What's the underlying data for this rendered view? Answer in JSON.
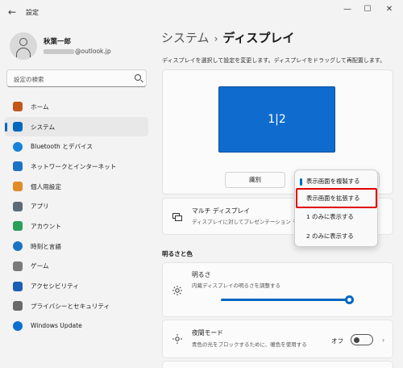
{
  "window": {
    "title": "設定",
    "back_icon": "arrow-left-icon",
    "min_glyph": "—",
    "max_glyph": "☐",
    "close_glyph": "✕"
  },
  "profile": {
    "name": "秋葉一郎",
    "email_suffix": "@outlook.jp"
  },
  "search": {
    "placeholder": "設定の検索"
  },
  "nav": [
    {
      "label": "ホーム",
      "icon": "home-icon",
      "color": "#c2571a"
    },
    {
      "label": "システム",
      "icon": "system-icon",
      "color": "#0067c0",
      "active": true
    },
    {
      "label": "Bluetooth とデバイス",
      "icon": "bluetooth-icon",
      "color": "#1583d8"
    },
    {
      "label": "ネットワークとインターネット",
      "icon": "network-icon",
      "color": "#1a73c4"
    },
    {
      "label": "個人用設定",
      "icon": "brush-icon",
      "color": "#e08a2a"
    },
    {
      "label": "アプリ",
      "icon": "apps-icon",
      "color": "#5c6a7a"
    },
    {
      "label": "アカウント",
      "icon": "account-icon",
      "color": "#2aa05a"
    },
    {
      "label": "時刻と言語",
      "icon": "time-language-icon",
      "color": "#1a73c4"
    },
    {
      "label": "ゲーム",
      "icon": "game-icon",
      "color": "#7a7a7a"
    },
    {
      "label": "アクセシビリティ",
      "icon": "accessibility-icon",
      "color": "#1a5fb4"
    },
    {
      "label": "プライバシーとセキュリティ",
      "icon": "shield-icon",
      "color": "#6a6a6a"
    },
    {
      "label": "Windows Update",
      "icon": "windows-update-icon",
      "color": "#0a6fd0"
    }
  ],
  "main": {
    "breadcrumb_parent": "システム",
    "breadcrumb_sep": "›",
    "breadcrumb_current": "ディスプレイ",
    "description": "ディスプレイを選択して設定を変更します。ディスプレイをドラッグして再配置します。",
    "monitor_label": "1|2",
    "identify_button": "識別",
    "dropdown": {
      "items": [
        "表示画面を複製する",
        "表示画面を拡張する",
        "1 のみに表示する",
        "2 のみに表示する"
      ],
      "selected_index": 0,
      "highlighted_index": 1,
      "highlight_color": "#e00000"
    },
    "multi_display": {
      "title": "マルチ ディスプレイ",
      "subtitle": "ディスプレイに対してプレゼンテーション モードを選択"
    },
    "section_brightness_color": "明るさと色",
    "brightness": {
      "title": "明るさ",
      "subtitle": "内蔵ディスプレイの明るさを調整する",
      "level_percent": 100
    },
    "night_light": {
      "title": "夜間モード",
      "subtitle": "青色の光をブロックするために、暖色を使用する",
      "toggle_label": "オフ",
      "toggle_on": false
    }
  },
  "colors": {
    "accent": "#0067c0",
    "monitor_fill": "#0f6cce",
    "background": "#f3f3f3",
    "card": "#fbfbfb"
  }
}
